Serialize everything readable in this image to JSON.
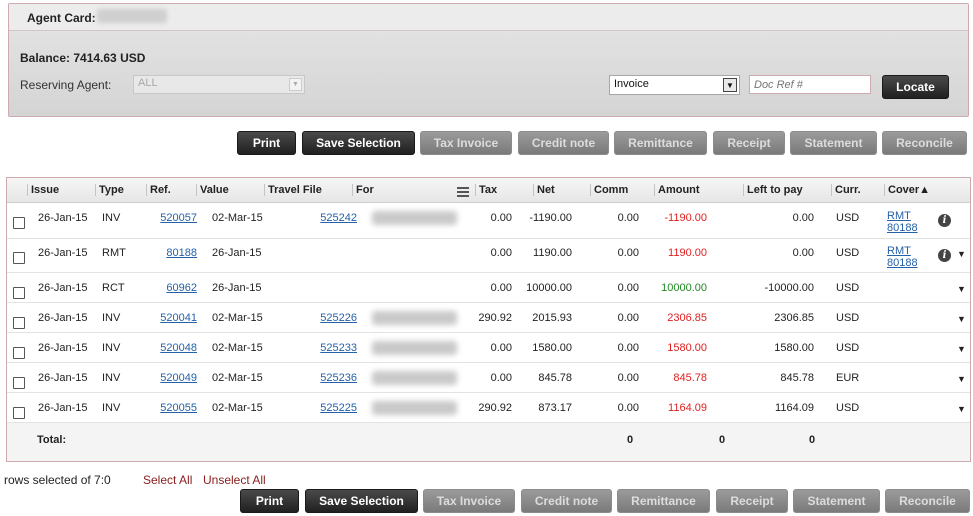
{
  "agent": {
    "card_label": "Agent Card:",
    "balance": "Balance: 7414.63 USD",
    "reserving_label": "Reserving Agent:",
    "reserving_value": "ALL"
  },
  "locate": {
    "doc_type": "Invoice",
    "doc_ref_placeholder": "Doc Ref #",
    "locate_label": "Locate"
  },
  "actions": {
    "print": "Print",
    "save_selection": "Save Selection",
    "tax_invoice": "Tax Invoice",
    "credit_note": "Credit note",
    "remittance": "Remittance",
    "receipt": "Receipt",
    "statement": "Statement",
    "reconcile": "Reconcile"
  },
  "table": {
    "headers": {
      "issue": "Issue",
      "type": "Type",
      "ref": "Ref.",
      "value": "Value",
      "travel_file": "Travel File",
      "for": "For",
      "tax": "Tax",
      "net": "Net",
      "comm": "Comm",
      "amount": "Amount",
      "left_to_pay": "Left to pay",
      "curr": "Curr.",
      "cover": "Cover▲"
    },
    "rows": [
      {
        "issue": "26-Jan-15",
        "type": "INV",
        "ref": "520057",
        "value": "02-Mar-15",
        "travel_file": "525242",
        "tax": "0.00",
        "net": "-1190.00",
        "comm": "0.00",
        "amount": "-1190.00",
        "left": "0.00",
        "curr": "USD",
        "cover1": "RMT",
        "cover2": "80188"
      },
      {
        "issue": "26-Jan-15",
        "type": "RMT",
        "ref": "80188",
        "value": "26-Jan-15",
        "travel_file": "",
        "tax": "0.00",
        "net": "1190.00",
        "comm": "0.00",
        "amount": "1190.00",
        "left": "0.00",
        "curr": "USD",
        "cover1": "RMT",
        "cover2": "80188"
      },
      {
        "issue": "26-Jan-15",
        "type": "RCT",
        "ref": "60962",
        "value": "26-Jan-15",
        "travel_file": "",
        "tax": "0.00",
        "net": "10000.00",
        "comm": "0.00",
        "amount": "10000.00",
        "left": "-10000.00",
        "curr": "USD",
        "cover1": "",
        "cover2": ""
      },
      {
        "issue": "26-Jan-15",
        "type": "INV",
        "ref": "520041",
        "value": "02-Mar-15",
        "travel_file": "525226",
        "tax": "290.92",
        "net": "2015.93",
        "comm": "0.00",
        "amount": "2306.85",
        "left": "2306.85",
        "curr": "USD",
        "cover1": "",
        "cover2": ""
      },
      {
        "issue": "26-Jan-15",
        "type": "INV",
        "ref": "520048",
        "value": "02-Mar-15",
        "travel_file": "525233",
        "tax": "0.00",
        "net": "1580.00",
        "comm": "0.00",
        "amount": "1580.00",
        "left": "1580.00",
        "curr": "USD",
        "cover1": "",
        "cover2": ""
      },
      {
        "issue": "26-Jan-15",
        "type": "INV",
        "ref": "520049",
        "value": "02-Mar-15",
        "travel_file": "525236",
        "tax": "0.00",
        "net": "845.78",
        "comm": "0.00",
        "amount": "845.78",
        "left": "845.78",
        "curr": "EUR",
        "cover1": "",
        "cover2": ""
      },
      {
        "issue": "26-Jan-15",
        "type": "INV",
        "ref": "520055",
        "value": "02-Mar-15",
        "travel_file": "525225",
        "tax": "290.92",
        "net": "873.17",
        "comm": "0.00",
        "amount": "1164.09",
        "left": "1164.09",
        "curr": "USD",
        "cover1": "",
        "cover2": ""
      }
    ],
    "total": {
      "label": "Total:",
      "comm": "0",
      "amount": "0",
      "left": "0"
    }
  },
  "footer": {
    "rows_selected": "rows selected of 7:0",
    "select_all": "Select All",
    "unselect_all": "Unselect All"
  },
  "colors": {
    "negative": "#e02020",
    "positive": "#228822",
    "link": "#2561a8"
  }
}
